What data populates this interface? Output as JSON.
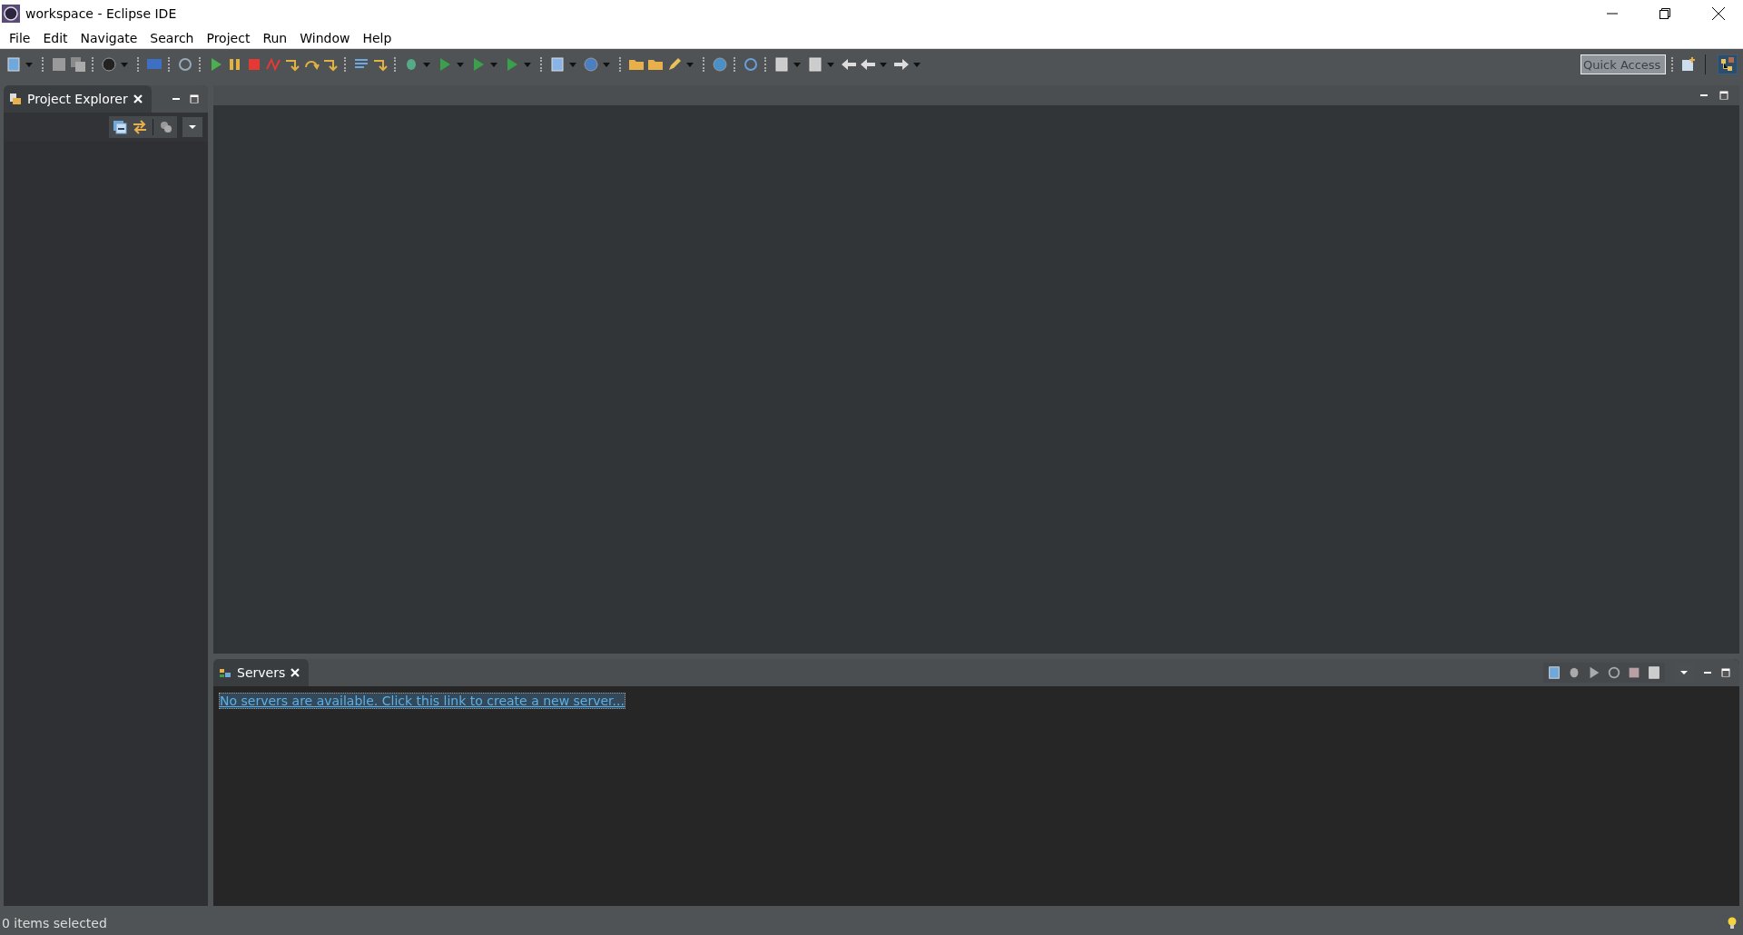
{
  "window": {
    "title": "workspace - Eclipse IDE"
  },
  "menu": [
    "File",
    "Edit",
    "Navigate",
    "Search",
    "Project",
    "Run",
    "Window",
    "Help"
  ],
  "quick_access": {
    "placeholder": "Quick Access"
  },
  "left_panel": {
    "tabs": [
      {
        "label": "Project Explorer",
        "selected": true
      }
    ]
  },
  "bottom_panel": {
    "tabs": [
      {
        "label": "Servers",
        "selected": true
      }
    ],
    "link": "No servers are available. Click this link to create a new server..."
  },
  "status_bar": {
    "text": "0 items selected"
  }
}
